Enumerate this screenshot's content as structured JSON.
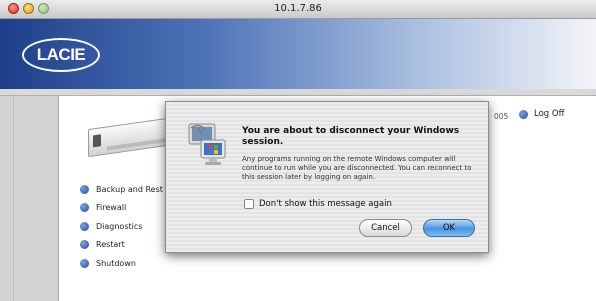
{
  "window": {
    "title": "10.1.7.86"
  },
  "header": {
    "logo_text": "LACIE"
  },
  "nav": {
    "logoff_label": "Log Off",
    "date_fragment": "005"
  },
  "menu": {
    "items": [
      {
        "label": "Backup and Rest",
        "icon": "blue-bullet-icon"
      },
      {
        "label": "Firewall",
        "icon": "blue-bullet-icon"
      },
      {
        "label": "Diagnostics",
        "icon": "blue-bullet-icon"
      },
      {
        "label": "Restart",
        "icon": "blue-bullet-icon"
      },
      {
        "label": "Shutdown",
        "icon": "blue-bullet-icon"
      }
    ]
  },
  "dialog": {
    "icon": "remote-desktop-icon",
    "heading": "You are about to disconnect your Windows session.",
    "body": "Any programs running on the remote Windows computer will continue to run while you are disconnected. You can reconnect to this session later by logging on again.",
    "checkbox_label": "Don't show this message again",
    "checkbox_checked": false,
    "cancel_label": "Cancel",
    "ok_label": "OK"
  },
  "colors": {
    "banner_dark": "#1d3f8a",
    "bullet_blue": "#1e4aa0",
    "default_button": "#4b94e0"
  }
}
